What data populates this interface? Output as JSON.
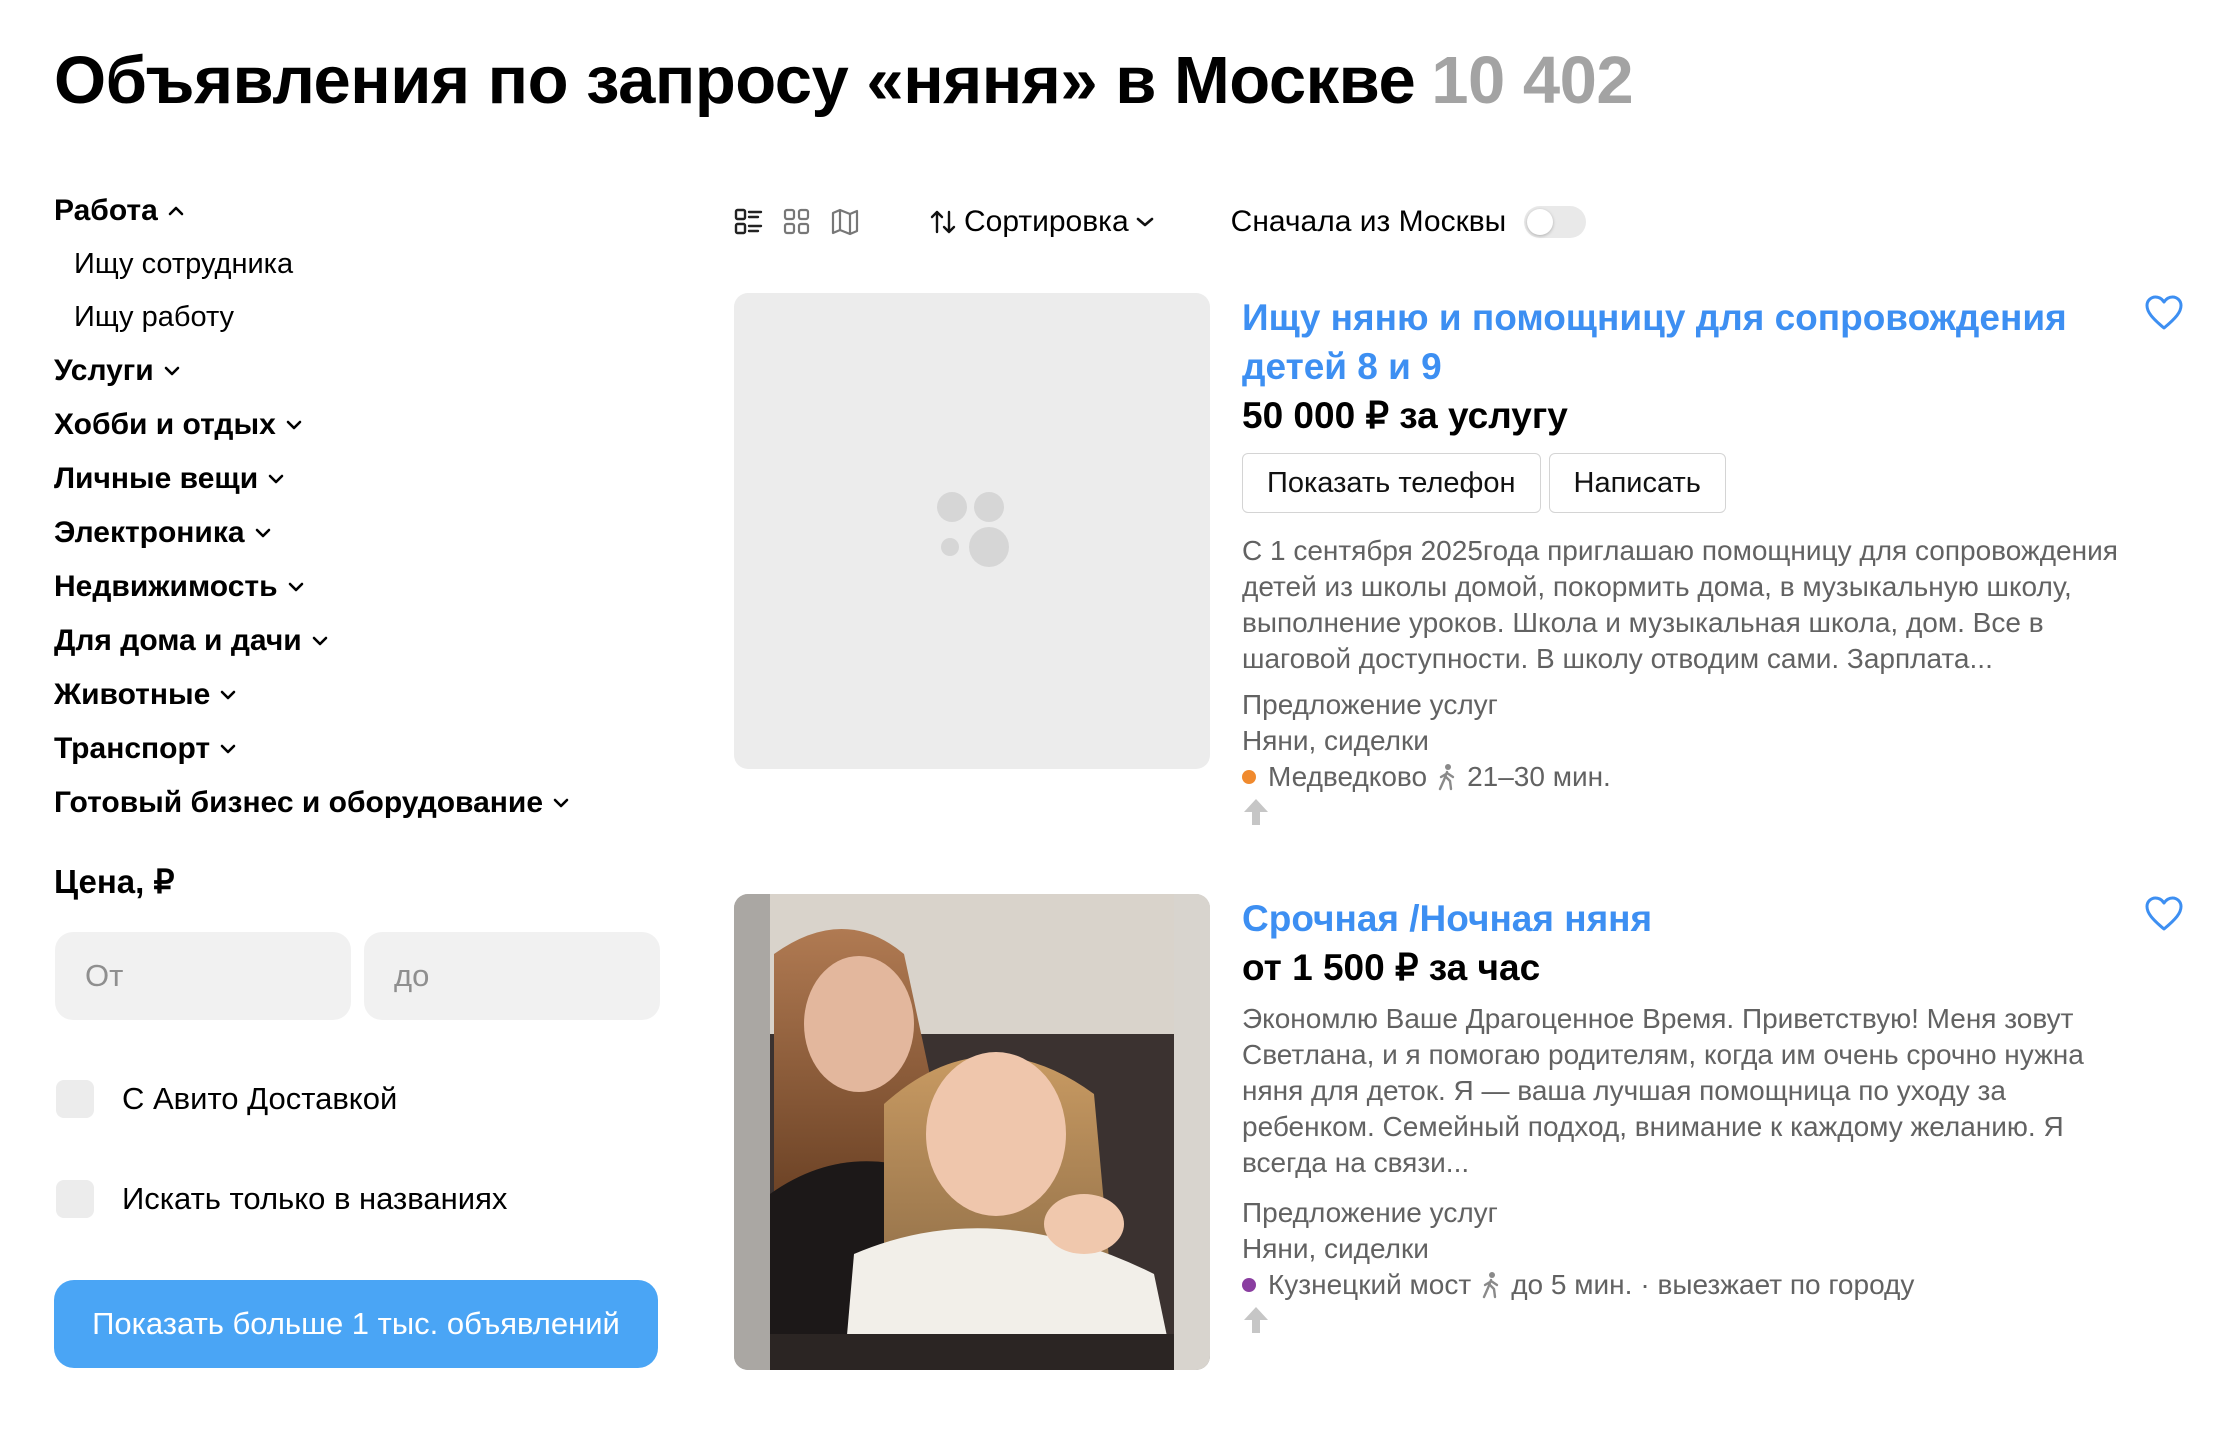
{
  "header": {
    "title": "Объявления по запросу «няня» в Москве",
    "count": "10 402"
  },
  "sidebar": {
    "categories": [
      {
        "label": "Работа",
        "expanded": true,
        "sub": [
          "Ищу сотрудника",
          "Ищу работу"
        ]
      },
      {
        "label": "Услуги"
      },
      {
        "label": "Хобби и отдых"
      },
      {
        "label": "Личные вещи"
      },
      {
        "label": "Электроника"
      },
      {
        "label": "Недвижимость"
      },
      {
        "label": "Для дома и дачи"
      },
      {
        "label": "Животные"
      },
      {
        "label": "Транспорт"
      },
      {
        "label": "Готовый бизнес и оборудование"
      }
    ],
    "price_title": "Цена, ₽",
    "price_from_placeholder": "От",
    "price_to_placeholder": "до",
    "delivery_label": "С Авито Доставкой",
    "titles_only_label": "Искать только в названиях",
    "show_more": "Показать больше 1 тыс. объявлений"
  },
  "toolbar": {
    "sort_label": "Сортировка",
    "moscow_first_label": "Сначала из Москвы",
    "moscow_first": false
  },
  "listings": [
    {
      "title": "Ищу няню и помощницу для сопровождения детей 8 и 9",
      "price": "50 000 ₽ за услугу",
      "show_phone": "Показать телефон",
      "write": "Написать",
      "description": "С 1 сентября 2025года приглашаю помощницу для сопровождения детей из школы домой, покормить дома, в музыкальную школу, выполнение уроков. Школа и музыкальная школа, дом. Все в шаговой доступности. В школу отводим сами. Зарплата...",
      "type": "Предложение услуг",
      "category": "Няни, сиделки",
      "metro": "Медведково",
      "metro_color": "#f08a2e",
      "walk_time": "21–30 мин.",
      "extra": ""
    },
    {
      "title": "Срочная /Ночная няня",
      "price": "от 1 500 ₽ за час",
      "description": "Экономлю Ваше Драгоценное Время. Приветствую! Меня зовут Светлана, и я помогаю родителям, когда им очень срочно нужна няня для деток. Я — ваша лучшая помощница по уходу за ребенком. Семейный подход, внимание к каждому желанию. Я всегда на связи...",
      "type": "Предложение услуг",
      "category": "Няни, сиделки",
      "metro": "Кузнецкий мост",
      "metro_color": "#8a3ea0",
      "walk_time": "до 5 мин.",
      "extra": "· выезжает по городу"
    }
  ]
}
